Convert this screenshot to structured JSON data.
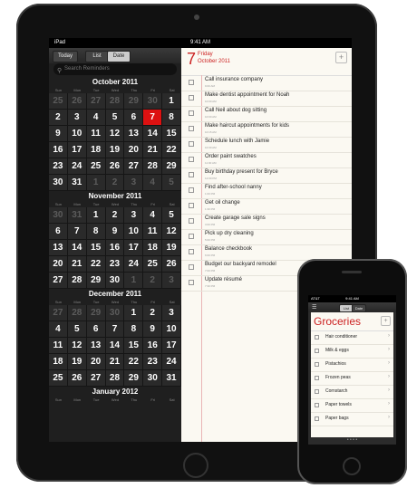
{
  "ipad": {
    "status": {
      "carrier": "iPad",
      "time": "9:41 AM"
    },
    "toolbar": {
      "today": "Today",
      "list": "List",
      "date": "Date"
    },
    "search_placeholder": "Search Reminders",
    "dow": [
      "Sun",
      "Mon",
      "Tue",
      "Wed",
      "Thu",
      "Fri",
      "Sat"
    ],
    "months": [
      {
        "title": "October 2011",
        "weeks": [
          [
            {
              "d": "25",
              "dim": true
            },
            {
              "d": "26",
              "dim": true
            },
            {
              "d": "27",
              "dim": true
            },
            {
              "d": "28",
              "dim": true
            },
            {
              "d": "29",
              "dim": true
            },
            {
              "d": "30",
              "dim": true
            },
            {
              "d": "1"
            }
          ],
          [
            {
              "d": "2"
            },
            {
              "d": "3"
            },
            {
              "d": "4"
            },
            {
              "d": "5"
            },
            {
              "d": "6"
            },
            {
              "d": "7",
              "sel": true
            },
            {
              "d": "8"
            }
          ],
          [
            {
              "d": "9"
            },
            {
              "d": "10"
            },
            {
              "d": "11"
            },
            {
              "d": "12"
            },
            {
              "d": "13"
            },
            {
              "d": "14"
            },
            {
              "d": "15"
            }
          ],
          [
            {
              "d": "16"
            },
            {
              "d": "17"
            },
            {
              "d": "18"
            },
            {
              "d": "19"
            },
            {
              "d": "20"
            },
            {
              "d": "21"
            },
            {
              "d": "22"
            }
          ],
          [
            {
              "d": "23"
            },
            {
              "d": "24"
            },
            {
              "d": "25"
            },
            {
              "d": "26"
            },
            {
              "d": "27"
            },
            {
              "d": "28"
            },
            {
              "d": "29"
            }
          ],
          [
            {
              "d": "30"
            },
            {
              "d": "31"
            },
            {
              "d": "1",
              "dim": true
            },
            {
              "d": "2",
              "dim": true
            },
            {
              "d": "3",
              "dim": true
            },
            {
              "d": "4",
              "dim": true
            },
            {
              "d": "5",
              "dim": true
            }
          ]
        ]
      },
      {
        "title": "November 2011",
        "weeks": [
          [
            {
              "d": "30",
              "dim": true
            },
            {
              "d": "31",
              "dim": true
            },
            {
              "d": "1"
            },
            {
              "d": "2"
            },
            {
              "d": "3"
            },
            {
              "d": "4"
            },
            {
              "d": "5"
            }
          ],
          [
            {
              "d": "6"
            },
            {
              "d": "7"
            },
            {
              "d": "8"
            },
            {
              "d": "9"
            },
            {
              "d": "10"
            },
            {
              "d": "11"
            },
            {
              "d": "12"
            }
          ],
          [
            {
              "d": "13"
            },
            {
              "d": "14"
            },
            {
              "d": "15"
            },
            {
              "d": "16"
            },
            {
              "d": "17"
            },
            {
              "d": "18"
            },
            {
              "d": "19"
            }
          ],
          [
            {
              "d": "20"
            },
            {
              "d": "21"
            },
            {
              "d": "22"
            },
            {
              "d": "23"
            },
            {
              "d": "24"
            },
            {
              "d": "25"
            },
            {
              "d": "26"
            }
          ],
          [
            {
              "d": "27"
            },
            {
              "d": "28"
            },
            {
              "d": "29"
            },
            {
              "d": "30"
            },
            {
              "d": "1",
              "dim": true
            },
            {
              "d": "2",
              "dim": true
            },
            {
              "d": "3",
              "dim": true
            }
          ]
        ]
      },
      {
        "title": "December 2011",
        "weeks": [
          [
            {
              "d": "27",
              "dim": true
            },
            {
              "d": "28",
              "dim": true
            },
            {
              "d": "29",
              "dim": true
            },
            {
              "d": "30",
              "dim": true
            },
            {
              "d": "1"
            },
            {
              "d": "2"
            },
            {
              "d": "3"
            }
          ],
          [
            {
              "d": "4"
            },
            {
              "d": "5"
            },
            {
              "d": "6"
            },
            {
              "d": "7"
            },
            {
              "d": "8"
            },
            {
              "d": "9"
            },
            {
              "d": "10"
            }
          ],
          [
            {
              "d": "11"
            },
            {
              "d": "12"
            },
            {
              "d": "13"
            },
            {
              "d": "14"
            },
            {
              "d": "15"
            },
            {
              "d": "16"
            },
            {
              "d": "17"
            }
          ],
          [
            {
              "d": "18"
            },
            {
              "d": "19"
            },
            {
              "d": "20"
            },
            {
              "d": "21"
            },
            {
              "d": "22"
            },
            {
              "d": "23"
            },
            {
              "d": "24"
            }
          ],
          [
            {
              "d": "25"
            },
            {
              "d": "26"
            },
            {
              "d": "27"
            },
            {
              "d": "28"
            },
            {
              "d": "29"
            },
            {
              "d": "30"
            },
            {
              "d": "31"
            }
          ]
        ]
      },
      {
        "title": "January 2012",
        "weeks": []
      }
    ],
    "selected": {
      "num": "7",
      "weekday": "Friday",
      "month": "October 2011"
    },
    "reminders": [
      {
        "title": "Call insurance company",
        "time": "9:00 AM"
      },
      {
        "title": "Make dentist appointment for Noah",
        "time": "10:00 AM"
      },
      {
        "title": "Call Neil about dog sitting",
        "time": "10:00 AM"
      },
      {
        "title": "Make haircut appointments for kids",
        "time": "10:15 AM"
      },
      {
        "title": "Schedule lunch with Jamie",
        "time": "10:30 AM"
      },
      {
        "title": "Order paint swatches",
        "time": "11:00 AM"
      },
      {
        "title": "Buy birthday present for Bryce",
        "time": "12:00 PM"
      },
      {
        "title": "Find after-school nanny",
        "time": "1:00 PM"
      },
      {
        "title": "Get oil change",
        "time": "1:30 PM"
      },
      {
        "title": "Create garage sale signs",
        "time": "3:00 PM"
      },
      {
        "title": "Pick up dry cleaning",
        "time": "5:00 PM"
      },
      {
        "title": "Balance checkbook",
        "time": "6:00 PM"
      },
      {
        "title": "Budget our backyard remodel",
        "time": "7:00 PM"
      },
      {
        "title": "Update résumé",
        "time": "7:30 PM"
      }
    ]
  },
  "iphone": {
    "status": {
      "carrier": "AT&T",
      "time": "9:41 AM"
    },
    "tabs": {
      "list": "List",
      "date": "Date"
    },
    "list_title": "Groceries",
    "items": [
      "Hair conditioner",
      "Milk & eggs",
      "Pistachios",
      "Frozen peas",
      "Cornstarch",
      "Paper towels",
      "Paper bags"
    ],
    "page_dots": "• • • •"
  }
}
